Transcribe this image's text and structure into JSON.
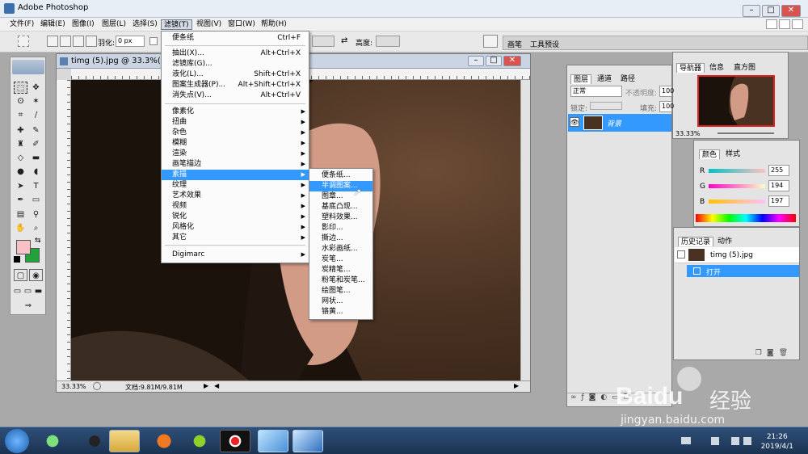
{
  "window": {
    "title": "Adobe Photoshop",
    "minimize": "–",
    "maximize": "□",
    "close": "✕"
  },
  "menubar": [
    "文件(F)",
    "编辑(E)",
    "图像(I)",
    "图层(L)",
    "选择(S)",
    "滤镜(T)",
    "视图(V)",
    "窗口(W)",
    "帮助(H)"
  ],
  "options": {
    "feather_label": "羽化:",
    "feather_value": "0 px",
    "height_label": "高度:"
  },
  "right_tabs": [
    "画笔",
    "工具预设"
  ],
  "document": {
    "title": "timg (5).jpg @ 33.3%(RGB",
    "zoom": "33.33%",
    "doc_info": "文档:9.81M/9.81M"
  },
  "filter_menu": {
    "group1": [
      {
        "label": "便条纸",
        "shortcut": "Ctrl+F"
      }
    ],
    "group2": [
      {
        "label": "抽出(X)...",
        "shortcut": "Alt+Ctrl+X"
      },
      {
        "label": "滤镜库(G)...",
        "shortcut": ""
      },
      {
        "label": "液化(L)...",
        "shortcut": "Shift+Ctrl+X"
      },
      {
        "label": "图案生成器(P)...",
        "shortcut": "Alt+Shift+Ctrl+X"
      },
      {
        "label": "消失点(V)...",
        "shortcut": "Alt+Ctrl+V"
      }
    ],
    "group3": [
      "像素化",
      "扭曲",
      "杂色",
      "模糊",
      "渲染",
      "画笔描边",
      "素描",
      "纹理",
      "艺术效果",
      "视频",
      "锐化",
      "风格化",
      "其它"
    ],
    "group4": [
      "Digimarc"
    ],
    "highlighted": "素描"
  },
  "sketch_submenu": {
    "items": [
      "便条纸...",
      "半调图案...",
      "图章...",
      "基底凸现...",
      "塑料效果...",
      "影印...",
      "撕边...",
      "水彩画纸...",
      "炭笔...",
      "炭精笔...",
      "粉笔和炭笔...",
      "绘图笔...",
      "网状...",
      "铬黄..."
    ],
    "highlighted": "半调图案..."
  },
  "navigator": {
    "tabs": [
      "导航器",
      "信息",
      "直方图"
    ],
    "zoom": "33.33%"
  },
  "color": {
    "tabs": [
      "颜色",
      "样式"
    ],
    "r_label": "R",
    "g_label": "G",
    "b_label": "B",
    "r": "255",
    "g": "194",
    "b": "197"
  },
  "layers": {
    "tabs": [
      "图层",
      "通道",
      "路径"
    ],
    "blend": "正常",
    "opacity_label": "不透明度:",
    "opacity_value": "100",
    "lock_label": "锁定:",
    "fill_label": "填充:",
    "fill_value": "100",
    "layer_name": "背景"
  },
  "history": {
    "tabs": [
      "历史记录",
      "动作"
    ],
    "snapshot": "timg (5).jpg",
    "step": "打开"
  },
  "taskbar": {
    "time": "21:26",
    "date": "2019/4/1"
  },
  "watermark": {
    "brand": "Bai",
    "suffix": "du",
    "cn": "经验",
    "url": "jingyan.baidu.com"
  },
  "colors": {
    "fg": "#f7c2c5",
    "bg": "#22a23a",
    "highlight": "#3399ff"
  }
}
